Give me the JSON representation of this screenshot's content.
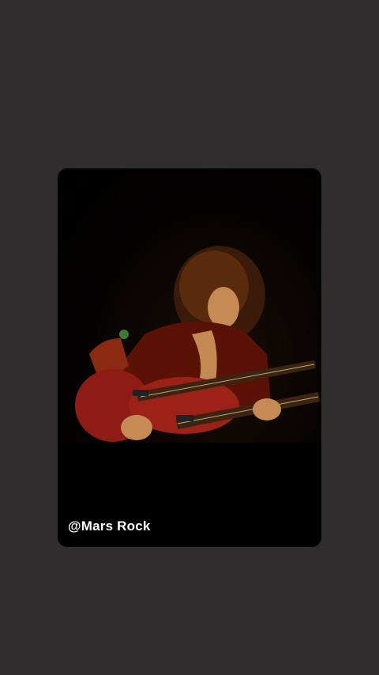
{
  "colors": {
    "page_background": "#2f2d2e",
    "card_background": "#000000",
    "watermark_text": "#ffffff"
  },
  "media": {
    "kind": "video-still",
    "subject": "guitarist-with-double-neck-guitar"
  },
  "watermark": {
    "text": "@Mars Rock"
  }
}
